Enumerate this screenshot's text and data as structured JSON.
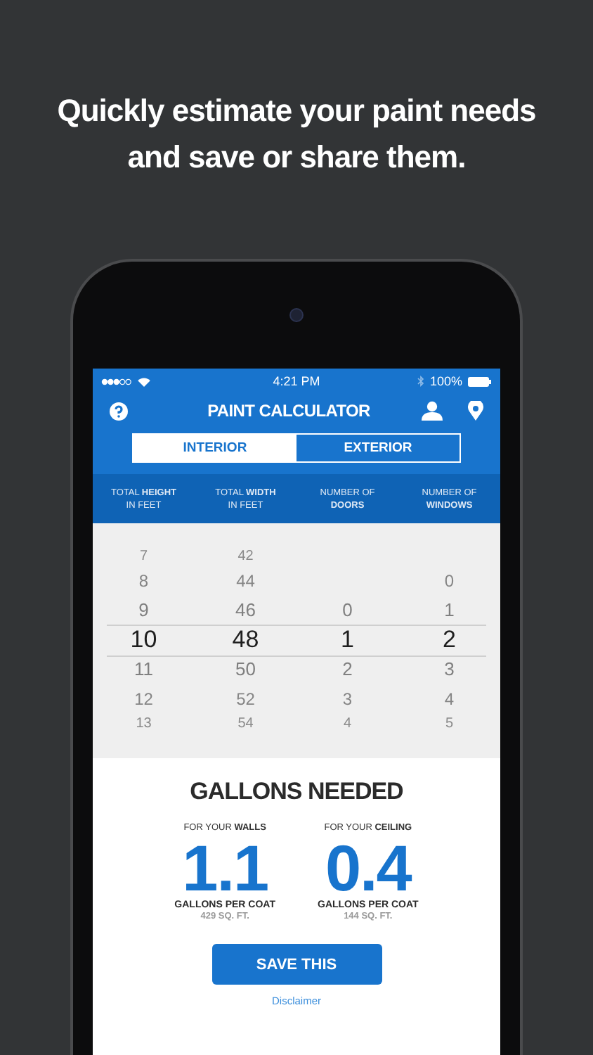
{
  "headline": "Quickly estimate your paint needs and save or share them.",
  "status_bar": {
    "time": "4:21 PM",
    "battery": "100%"
  },
  "header": {
    "title": "PAINT CALCULATOR"
  },
  "tabs": [
    {
      "label": "INTERIOR",
      "selected": true
    },
    {
      "label": "EXTERIOR",
      "selected": false
    }
  ],
  "pickers": [
    {
      "label": "TOTAL **HEIGHT**\nIN FEET",
      "items": [
        {
          "value": "7",
          "selected": false
        },
        {
          "value": "8",
          "selected": false
        },
        {
          "value": "9",
          "selected": false
        },
        {
          "value": "10",
          "selected": true
        },
        {
          "value": "11",
          "selected": false
        },
        {
          "value": "12",
          "selected": false
        },
        {
          "value": "13",
          "selected": false
        }
      ]
    },
    {
      "label": "TOTAL **WIDTH**\nIN FEET",
      "items": [
        {
          "value": "42",
          "selected": false
        },
        {
          "value": "44",
          "selected": false
        },
        {
          "value": "46",
          "selected": false
        },
        {
          "value": "48",
          "selected": true
        },
        {
          "value": "50",
          "selected": false
        },
        {
          "value": "52",
          "selected": false
        },
        {
          "value": "54",
          "selected": false
        }
      ]
    },
    {
      "label": "NUMBER OF\n**DOORS**",
      "items": [
        {
          "value": "0",
          "selected": false
        },
        {
          "value": "1",
          "selected": true
        },
        {
          "value": "2",
          "selected": false
        },
        {
          "value": "3",
          "selected": false
        },
        {
          "value": "4",
          "selected": false
        }
      ]
    },
    {
      "label": "NUMBER OF\n**WINDOWS**",
      "items": [
        {
          "value": "0",
          "selected": false
        },
        {
          "value": "1",
          "selected": false
        },
        {
          "value": "2",
          "selected": true
        },
        {
          "value": "3",
          "selected": false
        },
        {
          "value": "4",
          "selected": false
        },
        {
          "value": "5",
          "selected": false
        }
      ]
    }
  ],
  "results": {
    "title": "GALLONS NEEDED",
    "items": [
      {
        "label": "FOR YOUR **WALLS**",
        "value": "1.1",
        "unit": "GALLONS PER COAT",
        "area": "429 SQ. FT."
      },
      {
        "label": "FOR YOUR **CEILING**",
        "value": "0.4",
        "unit": "GALLONS PER COAT",
        "area": "144 SQ. FT."
      }
    ]
  },
  "save_button": "SAVE THIS",
  "disclaimer": "Disclaimer"
}
